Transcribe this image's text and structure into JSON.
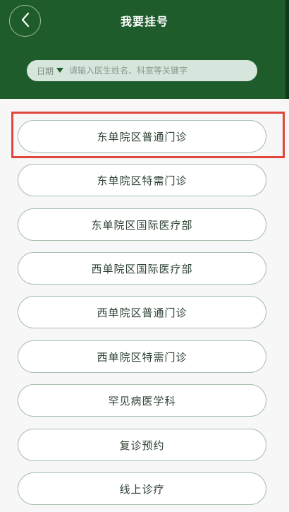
{
  "header": {
    "title": "我要挂号",
    "back": "back-arrow-icon"
  },
  "search": {
    "date_label": "日期",
    "placeholder": "请输入医生姓名、科室等关键字"
  },
  "departments": [
    {
      "label": "东单院区普通门诊"
    },
    {
      "label": "东单院区特需门诊"
    },
    {
      "label": "东单院区国际医疗部"
    },
    {
      "label": "西单院区国际医疗部"
    },
    {
      "label": "西单院区普通门诊"
    },
    {
      "label": "西单院区特需门诊"
    },
    {
      "label": "罕见病医学科"
    },
    {
      "label": "复诊预约"
    },
    {
      "label": "线上诊疗"
    }
  ],
  "colors": {
    "header_bg": "#1f5c2c",
    "highlight_border": "#e0473a"
  }
}
